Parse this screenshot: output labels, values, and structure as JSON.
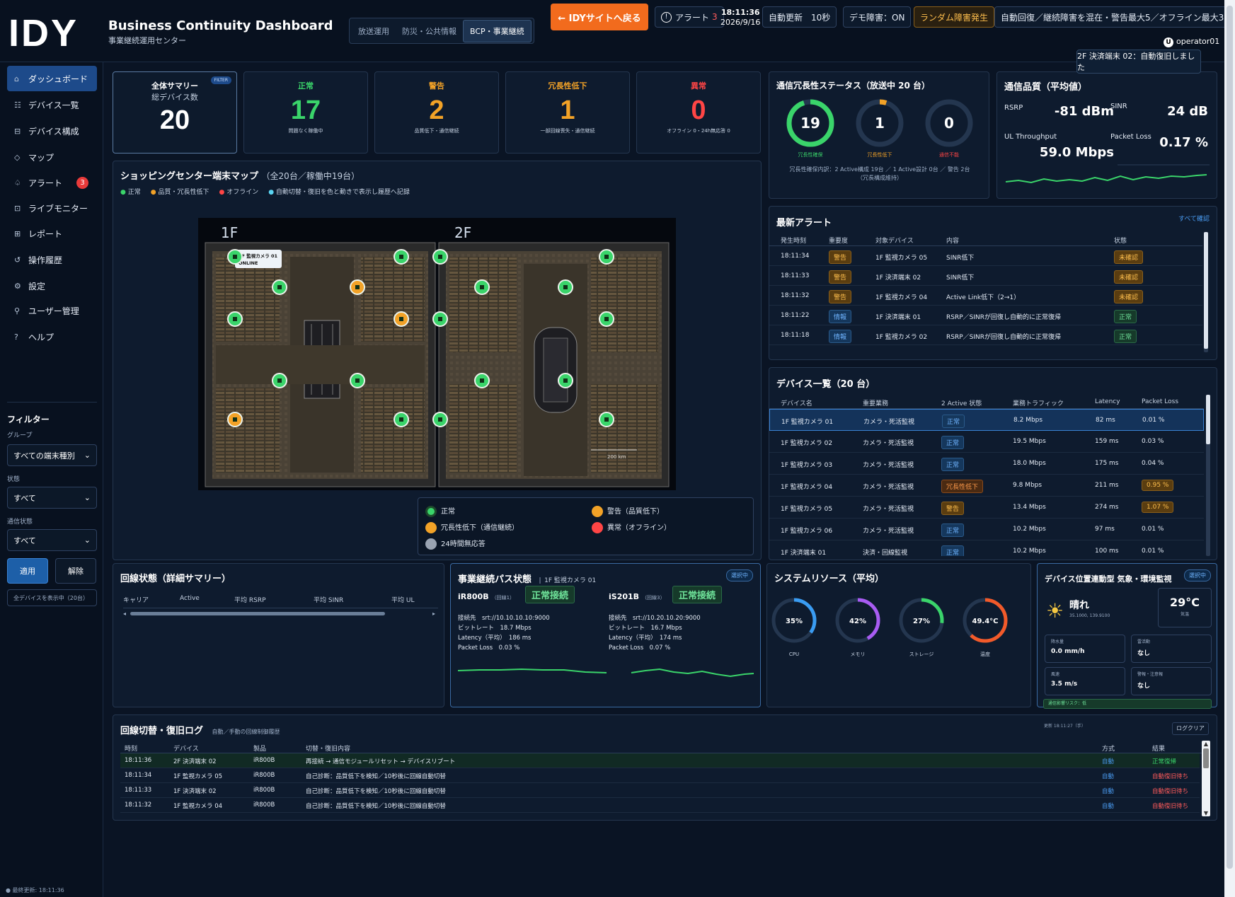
{
  "header": {
    "logo": "IDY",
    "title": "Business Continuity Dashboard",
    "subtitle": "事業継続運用センター",
    "modes": [
      "放送運用",
      "防災・公共情報",
      "BCP・事業継続"
    ],
    "back_label": "← IDYサイトへ戻る",
    "alert_label": "アラート",
    "alert_count": "3",
    "time": "18:11:36",
    "date": "2026/9/16",
    "auto_refresh": "自動更新　10秒",
    "demo": "デモ障害：ON",
    "random": "ランダム障害発生",
    "auto_recover": "自動回復／継続障害を混在・警告最大5／オフライン最大3",
    "user": "operator01",
    "toast": "2F 決済端末 02：自動復旧しました"
  },
  "sidebar": {
    "items": [
      {
        "icon": "⌂",
        "label": "ダッシュボード"
      },
      {
        "icon": "☷",
        "label": "デバイス一覧"
      },
      {
        "icon": "⊟",
        "label": "デバイス構成"
      },
      {
        "icon": "◇",
        "label": "マップ"
      },
      {
        "icon": "♤",
        "label": "アラート",
        "badge": "3"
      },
      {
        "icon": "⊡",
        "label": "ライブモニター"
      },
      {
        "icon": "⊞",
        "label": "レポート"
      },
      {
        "icon": "↺",
        "label": "操作履歴"
      },
      {
        "icon": "⚙",
        "label": "設定"
      },
      {
        "icon": "⚲",
        "label": "ユーザー管理"
      },
      {
        "icon": "?",
        "label": "ヘルプ"
      }
    ],
    "filter_title": "フィルター",
    "group_label": "グループ",
    "group_value": "すべての端末種別",
    "status_label": "状態",
    "status_value": "すべて",
    "comm_label": "通信状態",
    "comm_value": "すべて",
    "apply": "適用",
    "clear": "解除",
    "showing": "全デバイスを表示中（20台）",
    "last_update": "● 最終更新: 18:11:36"
  },
  "kpis": {
    "summary": {
      "title": "全体サマリー",
      "sub": "総デバイス数",
      "value": "20",
      "filter": "FILTER"
    },
    "normal": {
      "label": "正常",
      "value": "17",
      "sub": "問題なく稼働中",
      "color": "#3ad46a"
    },
    "warning": {
      "label": "警告",
      "value": "2",
      "sub": "品質低下・通信継続",
      "color": "#f2a227"
    },
    "degraded": {
      "label": "冗長性低下",
      "value": "1",
      "sub": "一部回線喪失・通信継続",
      "color": "#f2a227"
    },
    "error": {
      "label": "異常",
      "value": "0",
      "sub": "オフライン 0・24h無応答 0",
      "color": "#ff4545"
    }
  },
  "redundancy": {
    "title": "通信冗長性ステータス（放送中 20 台）",
    "rings": [
      {
        "value": "19",
        "label": "冗長性確保",
        "color": "#3ad46a",
        "frac": 0.95
      },
      {
        "value": "1",
        "label": "冗長性低下",
        "color": "#f2a227",
        "frac": 0.05
      },
      {
        "value": "0",
        "label": "通信不能",
        "color": "#ff4545",
        "frac": 0
      }
    ],
    "note": "冗長性確保内訳：2 Active構成 19台 ／ 1 Active設計 0台 ／ 警告 2台",
    "note2": "（冗長構成維持）"
  },
  "quality": {
    "title": "通信品質（平均値）",
    "rsrp_label": "RSRP",
    "rsrp": "-81 dBm",
    "sinr_label": "SINR",
    "sinr": "24 dB",
    "ul_label": "UL Throughput",
    "ul": "59.0 Mbps",
    "pl_label": "Packet Loss",
    "pl": "0.17 %"
  },
  "map": {
    "title": "ショッピングセンター端末マップ",
    "count": "（全20台／稼働中19台）",
    "legend_top": [
      "正常",
      "品質・冗長性低下",
      "オフライン",
      "自動切替・復旧を色と動きで表示し履歴へ記録"
    ],
    "floor1": "1F",
    "floor2": "2F",
    "popup_title": "1F 監視カメラ 01",
    "popup_status": "ONLINE",
    "scale": "200 km",
    "legend": [
      "正常",
      "警告（品質低下）",
      "冗長性低下（通信継続）",
      "異常（オフライン）",
      "24時間無応答"
    ]
  },
  "alerts": {
    "title": "最新アラート",
    "link": "すべて確認",
    "cols": [
      "発生時刻",
      "重要度",
      "対象デバイス",
      "内容",
      "状態"
    ],
    "rows": [
      [
        "18:11:34",
        "警告",
        "1F 監視カメラ 05",
        "SINR低下",
        "未確認"
      ],
      [
        "18:11:33",
        "警告",
        "1F 決済端末 02",
        "SINR低下",
        "未確認"
      ],
      [
        "18:11:32",
        "警告",
        "1F 監視カメラ 04",
        "Active Link低下（2→1）",
        "未確認"
      ],
      [
        "18:11:22",
        "情報",
        "1F 決済端末 01",
        "RSRP／SINRが回復し自動的に正常復帰",
        "正常"
      ],
      [
        "18:11:18",
        "情報",
        "1F 監視カメラ 02",
        "RSRP／SINRが回復し自動的に正常復帰",
        "正常"
      ]
    ]
  },
  "devices": {
    "title": "デバイス一覧（20 台）",
    "cols": [
      "デバイス名",
      "重要業務",
      "2 Active 状態",
      "業務トラフィック",
      "Latency",
      "Packet Loss"
    ],
    "rows": [
      [
        "1F 監視カメラ 01",
        "カメラ・死活監視",
        "正常",
        "8.2 Mbps",
        "82 ms",
        "0.01 %"
      ],
      [
        "1F 監視カメラ 02",
        "カメラ・死活監視",
        "正常",
        "19.5 Mbps",
        "159 ms",
        "0.03 %"
      ],
      [
        "1F 監視カメラ 03",
        "カメラ・死活監視",
        "正常",
        "18.0 Mbps",
        "175 ms",
        "0.04 %"
      ],
      [
        "1F 監視カメラ 04",
        "カメラ・死活監視",
        "冗長性低下",
        "9.8 Mbps",
        "211 ms",
        "0.95 %"
      ],
      [
        "1F 監視カメラ 05",
        "カメラ・死活監視",
        "警告",
        "13.4 Mbps",
        "274 ms",
        "1.07 %"
      ],
      [
        "1F 監視カメラ 06",
        "カメラ・死活監視",
        "正常",
        "10.2 Mbps",
        "97 ms",
        "0.01 %"
      ],
      [
        "1F 決済端末 01",
        "決済・回線監視",
        "正常",
        "10.2 Mbps",
        "100 ms",
        "0.01 %"
      ]
    ]
  },
  "line_state": {
    "title": "回線状態（詳細サマリー）",
    "cols": [
      "キャリア",
      "Active",
      "平均 RSRP",
      "平均 SINR",
      "平均 UL"
    ]
  },
  "bcp": {
    "title": "事業継続パス状態",
    "device": "1F 監視カメラ 01",
    "badge": "選択中",
    "paths": [
      {
        "name": "iR800B",
        "line": "（回線1）",
        "status": "正常接続",
        "dest": "接続先　srt://10.10.10.10:9000",
        "bitrate": "ビットレート　18.7 Mbps",
        "latency": "Latency（平均）　186 ms",
        "loss": "Packet Loss　0.03 %"
      },
      {
        "name": "iS201B",
        "line": "（回線3）",
        "status": "正常接続",
        "dest": "接続先　srt://10.20.10.20:9000",
        "bitrate": "ビットレート　16.7 Mbps",
        "latency": "Latency（平均）　174 ms",
        "loss": "Packet Loss　0.07 %"
      }
    ]
  },
  "system": {
    "title": "システムリソース（平均）",
    "gauges": [
      {
        "value": "35%",
        "label": "CPU",
        "frac": 0.35,
        "color": "#3a9cf2"
      },
      {
        "value": "42%",
        "label": "メモリ",
        "frac": 0.42,
        "color": "#a85cf2"
      },
      {
        "value": "27%",
        "label": "ストレージ",
        "frac": 0.27,
        "color": "#3ad46a"
      },
      {
        "value": "49.4°C",
        "label": "温度",
        "frac": 0.62,
        "color": "#f25a2a"
      }
    ]
  },
  "weather": {
    "title": "デバイス位置連動型 気象・環境監視",
    "badge": "選択中",
    "cond": "晴れ",
    "coords": "35.1000, 139.9100",
    "temp": "29°C",
    "temp_label": "気温",
    "cells": [
      {
        "label": "降水量",
        "value": "0.0 mm/h"
      },
      {
        "label": "雷活動",
        "value": "なし"
      },
      {
        "label": "風速",
        "value": "3.5 m/s"
      },
      {
        "label": "警報・注意報",
        "value": "なし"
      }
    ],
    "risk": "通信影響リスク：低"
  },
  "log": {
    "title": "回線切替・復旧ログ",
    "sub": "自動／手動の回線制御履歴",
    "updated": "更新 18:11:27（手）",
    "clear": "ログクリア",
    "cols": [
      "時刻",
      "デバイス",
      "製品",
      "切替・復旧内容",
      "方式",
      "結果"
    ],
    "rows": [
      [
        "18:11:36",
        "2F 決済端末 02",
        "iR800B",
        "再接続 → 通信モジュールリセット → デバイスリブート",
        "自動",
        "正常復帰"
      ],
      [
        "18:11:34",
        "1F 監視カメラ 05",
        "iR800B",
        "自己診断：品質低下を検知／10秒後に回線自動切替",
        "自動",
        "自動復旧待ち"
      ],
      [
        "18:11:33",
        "1F 決済端末 02",
        "iR800B",
        "自己診断：品質低下を検知／10秒後に回線自動切替",
        "自動",
        "自動復旧待ち"
      ],
      [
        "18:11:32",
        "1F 監視カメラ 04",
        "iR800B",
        "自己診断：品質低下を検知／10秒後に回線自動切替",
        "自動",
        "自動復旧待ち"
      ]
    ]
  }
}
